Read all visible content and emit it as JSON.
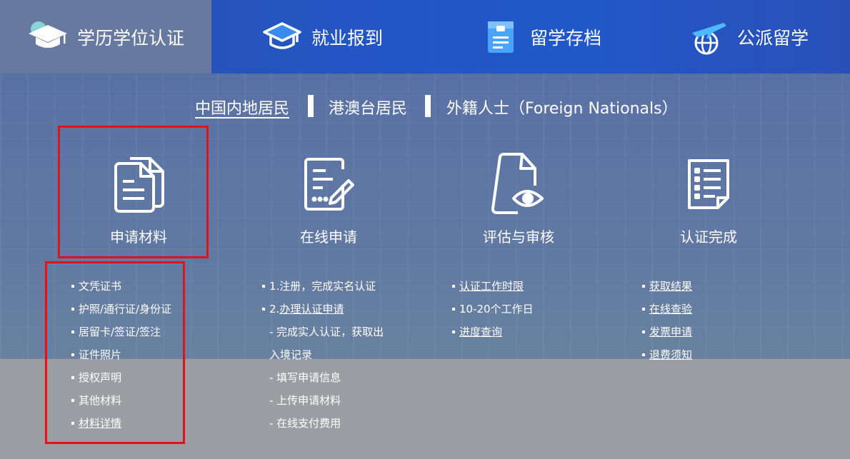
{
  "tabs": [
    {
      "label": "学历学位认证",
      "icon": "graduation-cap-icon",
      "active": true
    },
    {
      "label": "就业报到",
      "icon": "mortarboard-icon",
      "active": false
    },
    {
      "label": "留学存档",
      "icon": "archive-document-icon",
      "active": false
    },
    {
      "label": "公派留学",
      "icon": "plane-globe-icon",
      "active": false
    }
  ],
  "subnav": [
    {
      "label": "中国内地居民",
      "active": true
    },
    {
      "label": "港澳台居民",
      "active": false
    },
    {
      "label": "外籍人士（Foreign Nationals）",
      "active": false
    }
  ],
  "steps": [
    {
      "title": "申请材料",
      "icon": "documents-icon"
    },
    {
      "title": "在线申请",
      "icon": "form-edit-icon"
    },
    {
      "title": "评估与审核",
      "icon": "document-eye-icon"
    },
    {
      "title": "认证完成",
      "icon": "checklist-icon"
    }
  ],
  "materials": [
    {
      "text": "文凭证书",
      "link": false
    },
    {
      "text": "护照/通行证/身份证",
      "link": false
    },
    {
      "text": "居留卡/签证/签注",
      "link": false
    },
    {
      "text": "证件照片",
      "link": false
    },
    {
      "text": "授权声明",
      "link": false
    },
    {
      "text": "其他材料",
      "link": false
    },
    {
      "text": "材料详情",
      "link": true
    }
  ],
  "online": {
    "step1": "1.注册，完成实名认证",
    "step2_prefix": "2.",
    "step2_link": "办理认证申请",
    "sub1a": "- 完成实人认证，获取出",
    "sub1b": "入境记录",
    "sub2": "- 填写申请信息",
    "sub3": "- 上传申请材料",
    "sub4": "- 在线支付费用"
  },
  "review": [
    {
      "text": "认证工作时限",
      "link": true
    },
    {
      "text": "10-20个工作日",
      "link": false
    },
    {
      "text": "进度查询",
      "link": true
    }
  ],
  "complete": [
    {
      "text": "获取结果",
      "link": true
    },
    {
      "text": "在线查验",
      "link": true
    },
    {
      "text": "发票申请",
      "link": true
    },
    {
      "text": "退费须知",
      "link": true
    }
  ],
  "colors": {
    "nav": "#2356c4",
    "active_tab": "#67799f",
    "highlight_box": "#e4101a"
  }
}
